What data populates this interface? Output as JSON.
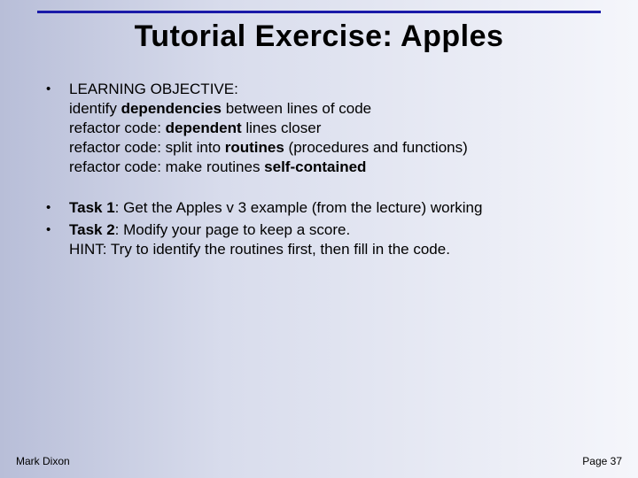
{
  "title": "Tutorial Exercise: Apples",
  "objective": {
    "label": "LEARNING OBJECTIVE:",
    "l1a": "identify ",
    "l1b": "dependencies",
    "l1c": " between lines of code",
    "l2a": "refactor code: ",
    "l2b": "dependent",
    "l2c": " lines closer",
    "l3a": "refactor code: split into ",
    "l3b": "routines",
    "l3c": " (procedures and functions)",
    "l4a": "refactor code: make routines ",
    "l4b": "self-contained"
  },
  "task1": {
    "labelA": "Task 1",
    "labelB": ": Get the Apples v 3 example (from the lecture) working"
  },
  "task2": {
    "labelA": "Task 2",
    "labelB": ": Modify your page to keep a score.",
    "hint": "HINT: Try to identify the routines first, then fill in the code."
  },
  "footer": {
    "author": "Mark Dixon",
    "page": "Page 37"
  }
}
